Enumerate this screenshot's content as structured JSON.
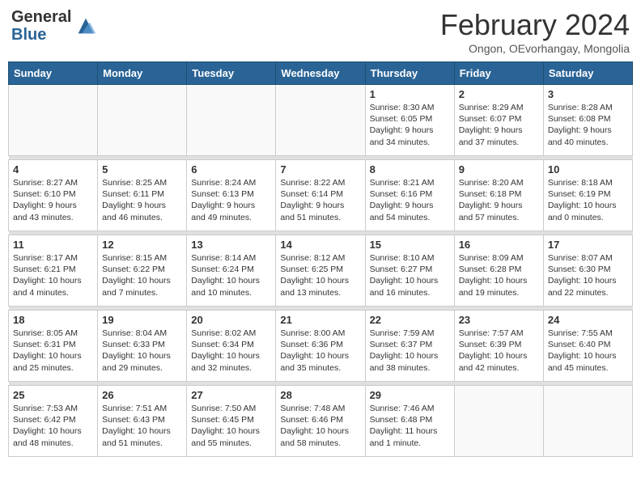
{
  "logo": {
    "general": "General",
    "blue": "Blue"
  },
  "title": "February 2024",
  "subtitle": "Ongon, OEvorhangay, Mongolia",
  "headers": [
    "Sunday",
    "Monday",
    "Tuesday",
    "Wednesday",
    "Thursday",
    "Friday",
    "Saturday"
  ],
  "weeks": [
    [
      {
        "num": "",
        "info": ""
      },
      {
        "num": "",
        "info": ""
      },
      {
        "num": "",
        "info": ""
      },
      {
        "num": "",
        "info": ""
      },
      {
        "num": "1",
        "info": "Sunrise: 8:30 AM\nSunset: 6:05 PM\nDaylight: 9 hours\nand 34 minutes."
      },
      {
        "num": "2",
        "info": "Sunrise: 8:29 AM\nSunset: 6:07 PM\nDaylight: 9 hours\nand 37 minutes."
      },
      {
        "num": "3",
        "info": "Sunrise: 8:28 AM\nSunset: 6:08 PM\nDaylight: 9 hours\nand 40 minutes."
      }
    ],
    [
      {
        "num": "4",
        "info": "Sunrise: 8:27 AM\nSunset: 6:10 PM\nDaylight: 9 hours\nand 43 minutes."
      },
      {
        "num": "5",
        "info": "Sunrise: 8:25 AM\nSunset: 6:11 PM\nDaylight: 9 hours\nand 46 minutes."
      },
      {
        "num": "6",
        "info": "Sunrise: 8:24 AM\nSunset: 6:13 PM\nDaylight: 9 hours\nand 49 minutes."
      },
      {
        "num": "7",
        "info": "Sunrise: 8:22 AM\nSunset: 6:14 PM\nDaylight: 9 hours\nand 51 minutes."
      },
      {
        "num": "8",
        "info": "Sunrise: 8:21 AM\nSunset: 6:16 PM\nDaylight: 9 hours\nand 54 minutes."
      },
      {
        "num": "9",
        "info": "Sunrise: 8:20 AM\nSunset: 6:18 PM\nDaylight: 9 hours\nand 57 minutes."
      },
      {
        "num": "10",
        "info": "Sunrise: 8:18 AM\nSunset: 6:19 PM\nDaylight: 10 hours\nand 0 minutes."
      }
    ],
    [
      {
        "num": "11",
        "info": "Sunrise: 8:17 AM\nSunset: 6:21 PM\nDaylight: 10 hours\nand 4 minutes."
      },
      {
        "num": "12",
        "info": "Sunrise: 8:15 AM\nSunset: 6:22 PM\nDaylight: 10 hours\nand 7 minutes."
      },
      {
        "num": "13",
        "info": "Sunrise: 8:14 AM\nSunset: 6:24 PM\nDaylight: 10 hours\nand 10 minutes."
      },
      {
        "num": "14",
        "info": "Sunrise: 8:12 AM\nSunset: 6:25 PM\nDaylight: 10 hours\nand 13 minutes."
      },
      {
        "num": "15",
        "info": "Sunrise: 8:10 AM\nSunset: 6:27 PM\nDaylight: 10 hours\nand 16 minutes."
      },
      {
        "num": "16",
        "info": "Sunrise: 8:09 AM\nSunset: 6:28 PM\nDaylight: 10 hours\nand 19 minutes."
      },
      {
        "num": "17",
        "info": "Sunrise: 8:07 AM\nSunset: 6:30 PM\nDaylight: 10 hours\nand 22 minutes."
      }
    ],
    [
      {
        "num": "18",
        "info": "Sunrise: 8:05 AM\nSunset: 6:31 PM\nDaylight: 10 hours\nand 25 minutes."
      },
      {
        "num": "19",
        "info": "Sunrise: 8:04 AM\nSunset: 6:33 PM\nDaylight: 10 hours\nand 29 minutes."
      },
      {
        "num": "20",
        "info": "Sunrise: 8:02 AM\nSunset: 6:34 PM\nDaylight: 10 hours\nand 32 minutes."
      },
      {
        "num": "21",
        "info": "Sunrise: 8:00 AM\nSunset: 6:36 PM\nDaylight: 10 hours\nand 35 minutes."
      },
      {
        "num": "22",
        "info": "Sunrise: 7:59 AM\nSunset: 6:37 PM\nDaylight: 10 hours\nand 38 minutes."
      },
      {
        "num": "23",
        "info": "Sunrise: 7:57 AM\nSunset: 6:39 PM\nDaylight: 10 hours\nand 42 minutes."
      },
      {
        "num": "24",
        "info": "Sunrise: 7:55 AM\nSunset: 6:40 PM\nDaylight: 10 hours\nand 45 minutes."
      }
    ],
    [
      {
        "num": "25",
        "info": "Sunrise: 7:53 AM\nSunset: 6:42 PM\nDaylight: 10 hours\nand 48 minutes."
      },
      {
        "num": "26",
        "info": "Sunrise: 7:51 AM\nSunset: 6:43 PM\nDaylight: 10 hours\nand 51 minutes."
      },
      {
        "num": "27",
        "info": "Sunrise: 7:50 AM\nSunset: 6:45 PM\nDaylight: 10 hours\nand 55 minutes."
      },
      {
        "num": "28",
        "info": "Sunrise: 7:48 AM\nSunset: 6:46 PM\nDaylight: 10 hours\nand 58 minutes."
      },
      {
        "num": "29",
        "info": "Sunrise: 7:46 AM\nSunset: 6:48 PM\nDaylight: 11 hours\nand 1 minute."
      },
      {
        "num": "",
        "info": ""
      },
      {
        "num": "",
        "info": ""
      }
    ]
  ]
}
